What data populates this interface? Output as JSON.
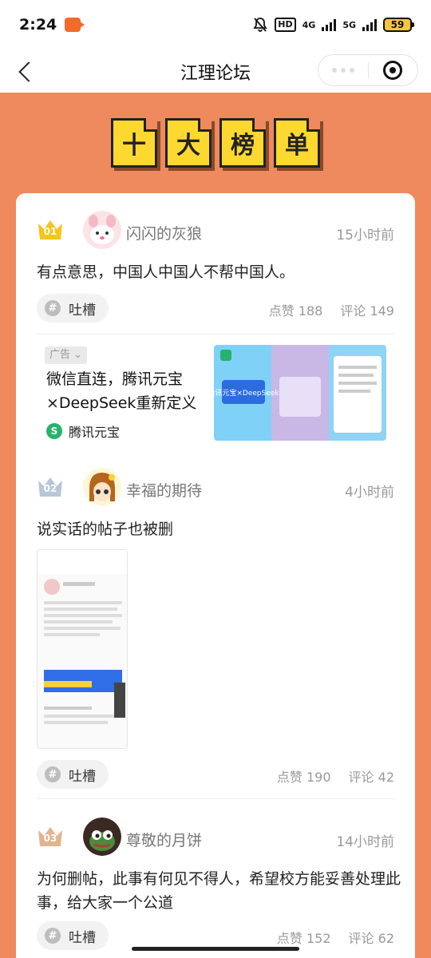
{
  "status_bar": {
    "time": "2:24",
    "network1": "4G",
    "network2": "5G",
    "hd": "HD",
    "battery": "59"
  },
  "nav": {
    "title": "江理论坛"
  },
  "banner": {
    "chars": [
      "十",
      "大",
      "榜",
      "单"
    ]
  },
  "posts": [
    {
      "rank": "01",
      "username": "闪闪的灰狼",
      "time": "15小时前",
      "text": "有点意思，中国人中国人不帮中国人。",
      "tag": "吐槽",
      "likes": "点赞 188",
      "comments": "评论 149"
    },
    {
      "rank": "02",
      "username": "幸福的期待",
      "time": "4小时前",
      "text": "说实话的帖子也被删",
      "tag": "吐槽",
      "likes": "点赞 190",
      "comments": "评论 42"
    },
    {
      "rank": "03",
      "username": "尊敬的月饼",
      "time": "14小时前",
      "text": "为何删帖，此事有何见不得人，希望校方能妥善处理此事，给大家一个公道",
      "tag": "吐槽",
      "likes": "点赞 152",
      "comments": "评论 62"
    }
  ],
  "ad": {
    "label": "广告",
    "title": "微信直连，腾讯元宝×DeepSeek重新定义",
    "brand": "腾讯元宝",
    "image_text": "腾讯元宝×DeepSeek"
  },
  "colors": {
    "background": "#EE8A5E",
    "banner_tile": "#FDD830",
    "rank1": "#F5C518",
    "rank2": "#B8C6D8",
    "rank3": "#E2B48E"
  }
}
